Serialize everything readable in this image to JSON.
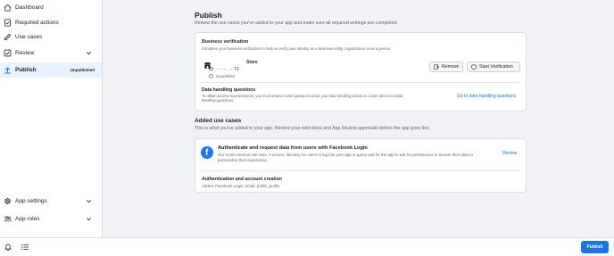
{
  "sidebar": {
    "items": [
      {
        "label": "Dashboard",
        "icon": "home-icon"
      },
      {
        "label": "Required actions",
        "icon": "clipboard-check-icon"
      },
      {
        "label": "Use cases",
        "icon": "pencil-icon"
      },
      {
        "label": "Review",
        "icon": "checkbox-icon"
      },
      {
        "label": "Publish",
        "icon": "upload-icon",
        "tag": "Unpublished"
      },
      {
        "label": "App settings",
        "icon": "gear-icon"
      },
      {
        "label": "App roles",
        "icon": "users-icon"
      }
    ]
  },
  "main": {
    "title": "Publish",
    "subtitle": "Review the use cases you've added to your app and make sure all required settings are completed.",
    "business_verification": {
      "title": "Business verification",
      "description": "Complete your business verification to help us verify your identity as a business entity, organization or as a person.",
      "store_name": "Store",
      "id_label": "ID:",
      "id_value": "··· ··· ···71",
      "status": "Unverified",
      "remove_label": "Remove",
      "start_label": "Start Verification"
    },
    "data_handling": {
      "title": "Data handling questions",
      "description": "To obtain access to permissions, you must answer some questions about your data handling practices. Learn about our data handling guidelines.",
      "link": "Go to data handling questions"
    },
    "added_use_cases": {
      "title": "Added use cases",
      "subtitle": "This is what you've added to your app. Review your selections and App Review approvals before the app goes live.",
      "use_case_title": "Authenticate and request data from users with Facebook Login",
      "use_case_desc": "Our most common use case. A secure, fast way for users to log into your app or game and for the app to ask for permissions to access their data to personalize their experience.",
      "review_link": "Review",
      "auth_title": "Authentication and account creation",
      "auth_desc": "Added: Facebook Login, email, public_profile"
    }
  },
  "footer": {
    "publish_label": "Publish"
  },
  "colors": {
    "accent": "#1b74e4",
    "facebook": "#1877f2",
    "active_bg": "#e7f3ff"
  }
}
